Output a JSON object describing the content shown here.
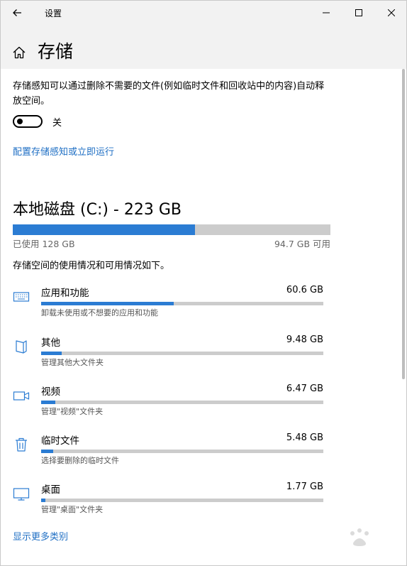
{
  "window": {
    "title": "设置"
  },
  "page": {
    "title": "存储"
  },
  "storage_sense": {
    "description": "存储感知可以通过删除不需要的文件(例如临时文件和回收站中的内容)自动释放空间。",
    "toggle_state": "关",
    "toggle_on": false,
    "config_link": "配置存储感知或立即运行"
  },
  "drive": {
    "title": "本地磁盘 (C:) - 223 GB",
    "used_label": "已使用 128 GB",
    "free_label": "94.7 GB 可用",
    "used_fraction": 0.574
  },
  "usage": {
    "description": "存储空间的使用情况和可用情况如下。",
    "categories": [
      {
        "name": "应用和功能",
        "size": "60.6 GB",
        "subtitle": "卸载未使用或不想要的应用和功能",
        "fraction": 0.47,
        "icon": "keyboard-icon"
      },
      {
        "name": "其他",
        "size": "9.48 GB",
        "subtitle": "管理其他大文件夹",
        "fraction": 0.074,
        "icon": "book-icon"
      },
      {
        "name": "视频",
        "size": "6.47 GB",
        "subtitle": "管理\"视频\"文件夹",
        "fraction": 0.05,
        "icon": "video-camera-icon"
      },
      {
        "name": "临时文件",
        "size": "5.48 GB",
        "subtitle": "选择要删除的临时文件",
        "fraction": 0.043,
        "icon": "trash-icon"
      },
      {
        "name": "桌面",
        "size": "1.77 GB",
        "subtitle": "管理\"桌面\"文件夹",
        "fraction": 0.014,
        "icon": "monitor-icon"
      }
    ],
    "more_link": "显示更多类别"
  },
  "colors": {
    "accent": "#2b7cd3",
    "link": "#1f6fc4",
    "track": "#cccccc",
    "header_bg": "#f2f2f2"
  }
}
